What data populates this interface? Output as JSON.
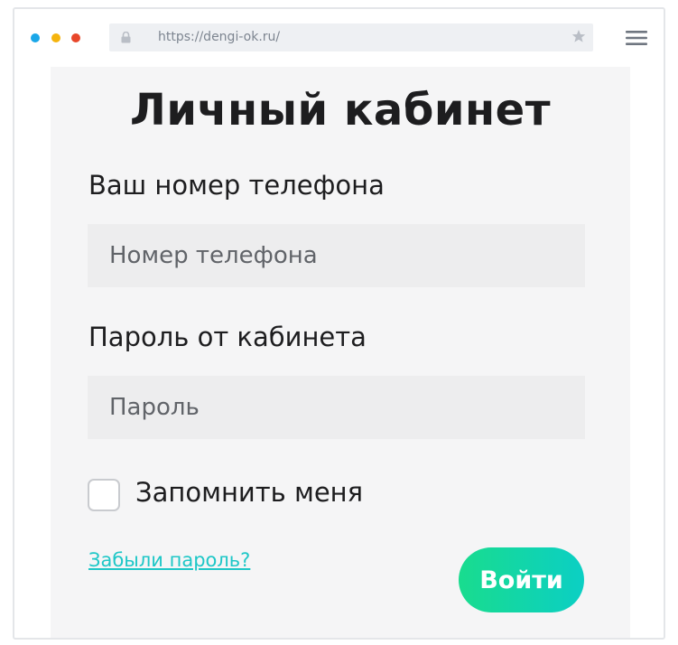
{
  "browser": {
    "url": "https://dengi-ok.ru/",
    "dot_colors": {
      "blue": "#1aa7e8",
      "yellow": "#f5b40e",
      "red": "#e8472a"
    },
    "icons": {
      "lock": "lock-icon",
      "star": "star-icon",
      "menu": "hamburger-menu-icon"
    }
  },
  "login": {
    "title": "Личный кабинет",
    "phone_label": "Ваш номер телефона",
    "phone_placeholder": "Номер телефона",
    "phone_value": "",
    "password_label": "Пароль от кабинета",
    "password_placeholder": "Пароль",
    "password_value": "",
    "remember_label": "Запомнить меня",
    "remember_checked": false,
    "forgot_link": "Забыли пароль?",
    "submit_label": "Войти"
  },
  "colors": {
    "accent_gradient_start": "#19dc8e",
    "accent_gradient_end": "#0bcfc4",
    "link": "#1ec7c7"
  }
}
